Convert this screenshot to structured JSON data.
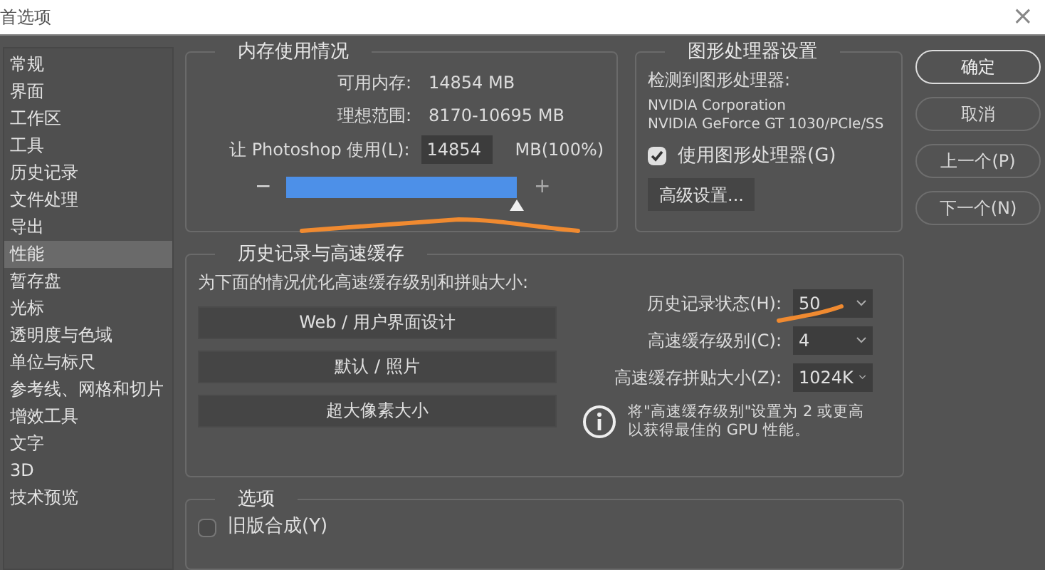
{
  "window": {
    "title": "首选项",
    "close": "×"
  },
  "sidebar": {
    "items": [
      {
        "label": "常规",
        "selected": false
      },
      {
        "label": "界面",
        "selected": false
      },
      {
        "label": "工作区",
        "selected": false
      },
      {
        "label": "工具",
        "selected": false
      },
      {
        "label": "历史记录",
        "selected": false
      },
      {
        "label": "文件处理",
        "selected": false
      },
      {
        "label": "导出",
        "selected": false
      },
      {
        "label": "性能",
        "selected": true
      },
      {
        "label": "暂存盘",
        "selected": false
      },
      {
        "label": "光标",
        "selected": false
      },
      {
        "label": "透明度与色域",
        "selected": false
      },
      {
        "label": "单位与标尺",
        "selected": false
      },
      {
        "label": "参考线、网格和切片",
        "selected": false
      },
      {
        "label": "增效工具",
        "selected": false
      },
      {
        "label": "文字",
        "selected": false
      },
      {
        "label": "3D",
        "selected": false
      },
      {
        "label": "技术预览",
        "selected": false
      }
    ]
  },
  "memory": {
    "title": "内存使用情况",
    "available_label": "可用内存:",
    "available_value": "14854 MB",
    "ideal_label": "理想范围:",
    "ideal_value": "8170-10695 MB",
    "use_label": "让 Photoshop 使用(L):",
    "use_value": "14854",
    "use_suffix": "MB(100%)",
    "minus": "−",
    "plus": "+",
    "level": 1
  },
  "gpu": {
    "title": "图形处理器设置",
    "detected_label": "检测到图形处理器:",
    "vendor": "NVIDIA Corporation",
    "model": "NVIDIA GeForce GT 1030/PCIe/SS",
    "use_gpu": {
      "label": "使用图形处理器(G)",
      "checked": true
    },
    "advanced_button": "高级设置..."
  },
  "history": {
    "title": "历史记录与高速缓存",
    "prompt": "为下面的情况优化高速缓存级别和拼贴大小:",
    "presets": [
      "Web / 用户界面设计",
      "默认 / 照片",
      "超大像素大小"
    ],
    "fields": [
      {
        "label": "历史记录状态(H):",
        "value": "50"
      },
      {
        "label": "高速缓存级别(C):",
        "value": "4"
      },
      {
        "label": "高速缓存拼贴大小(Z):",
        "value": "1024K"
      }
    ],
    "info_text": "将\"高速缓存级别\"设置为 2 或更高以获得最佳的 GPU 性能。"
  },
  "options": {
    "title": "选项",
    "legacy": {
      "label": "旧版合成(Y)",
      "checked": false
    }
  },
  "buttons": [
    {
      "label": "确定",
      "default": true
    },
    {
      "label": "取消",
      "default": false
    },
    {
      "label": "上一个(P)",
      "default": false
    },
    {
      "label": "下一个(N)",
      "default": false
    }
  ]
}
